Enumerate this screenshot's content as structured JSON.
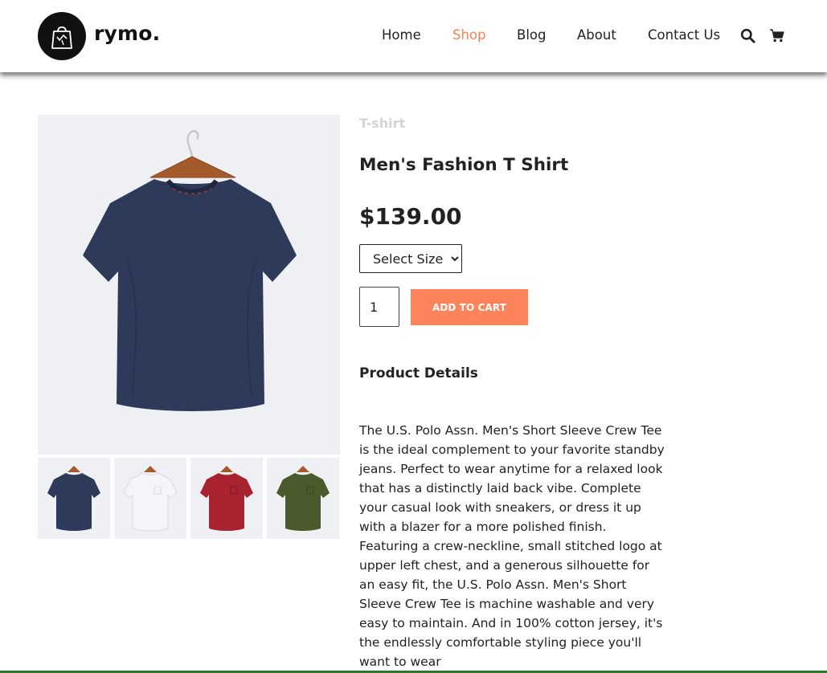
{
  "brand": {
    "name": "rymo."
  },
  "nav": {
    "items": [
      {
        "label": "Home"
      },
      {
        "label": "Shop"
      },
      {
        "label": "Blog"
      },
      {
        "label": "About"
      },
      {
        "label": "Contact Us"
      }
    ],
    "active": "Shop"
  },
  "header_icons": [
    "search-icon",
    "cart-icon"
  ],
  "product": {
    "category": "T-shirt",
    "title": "Men's Fashion T Shirt",
    "price": "$139.00",
    "size_select": "Select Size",
    "quantity": "1",
    "add_to_cart": "ADD TO CART",
    "details_heading": "Product Details",
    "description": "The U.S. Polo Assn. Men's Short Sleeve Crew Tee is the ideal complement to your favorite standby jeans. Perfect to wear anytime for a relaxed look that has a distinctly laid back vibe. Complete your casual look with sneakers, or dress it up with a blazer for a more polished finish. Featuring a crew-neckline, small stitched logo at upper left chest, and a generous silhouette for an easy fit, the U.S. Polo Assn. Men's Short Sleeve Crew Tee is machine washable and very easy to maintain. And in 100% cotton jersey, it's the endlessly comfortable styling piece you'll want to wear"
  },
  "colors": {
    "accent": "#f58453",
    "button": "#fd845a",
    "shirt_colors": [
      "#2e3a5a",
      "#f4f5f8",
      "#a8232f",
      "#4b5a2c"
    ]
  }
}
